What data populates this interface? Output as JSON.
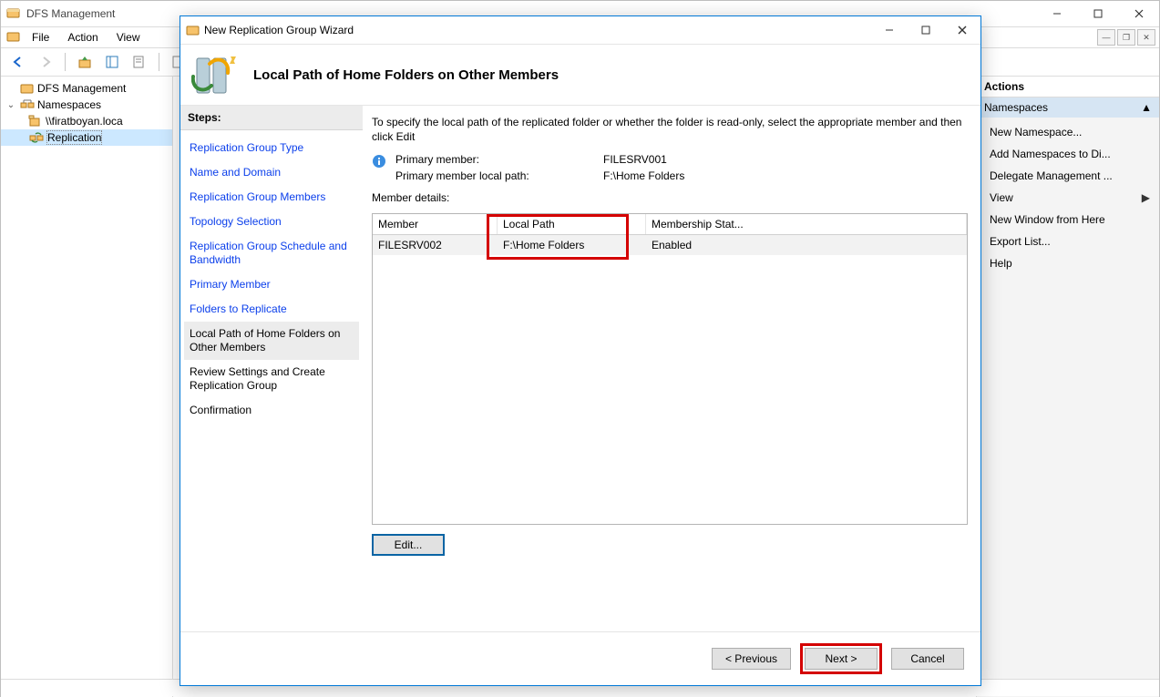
{
  "app": {
    "title": "DFS Management"
  },
  "menu": {
    "file": "File",
    "action": "Action",
    "view": "View"
  },
  "tree": {
    "root": "DFS Management",
    "namespaces": "Namespaces",
    "ns_item": "\\\\firatboyan.loca",
    "replication": "Replication"
  },
  "actions": {
    "header": "Actions",
    "section": "Namespaces",
    "items": {
      "new_namespace": "New Namespace...",
      "add_namespaces": "Add Namespaces to Di...",
      "delegate": "Delegate Management ...",
      "view": "View",
      "new_window": "New Window from Here",
      "export": "Export List...",
      "help": "Help"
    }
  },
  "dialog": {
    "title": "New Replication Group Wizard",
    "banner_title": "Local Path of Home Folders on Other Members",
    "steps_label": "Steps:",
    "steps": {
      "s1": "Replication Group Type",
      "s2": "Name and Domain",
      "s3": "Replication Group Members",
      "s4": "Topology Selection",
      "s5": "Replication Group Schedule and Bandwidth",
      "s6": "Primary Member",
      "s7": "Folders to Replicate",
      "s8": "Local Path of Home Folders on Other Members",
      "s9": "Review Settings and Create Replication Group",
      "s10": "Confirmation"
    },
    "intro": "To specify the local path of the replicated folder or whether the folder is read-only, select the appropriate member and then click Edit",
    "info": {
      "label_primary_member": "Primary member:",
      "primary_member": "FILESRV001",
      "label_primary_path": "Primary member local path:",
      "primary_path": "F:\\Home Folders"
    },
    "member_details_label": "Member details:",
    "table": {
      "cols": {
        "member": "Member",
        "local_path": "Local Path",
        "status": "Membership Stat..."
      },
      "rows": [
        {
          "member": "FILESRV002",
          "local_path": "F:\\Home Folders",
          "status": "Enabled"
        }
      ]
    },
    "buttons": {
      "edit": "Edit...",
      "previous": "< Previous",
      "next": "Next >",
      "cancel": "Cancel"
    }
  }
}
